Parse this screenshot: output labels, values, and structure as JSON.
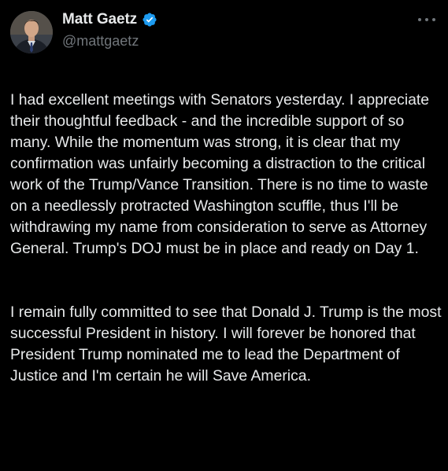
{
  "author": {
    "display_name": "Matt Gaetz",
    "handle": "@mattgaetz",
    "verified": true,
    "avatar_icon": "profile-photo"
  },
  "colors": {
    "background": "#000000",
    "text": "#e7e9ea",
    "secondary": "#71767b",
    "verified": "#1d9bf0"
  },
  "tweet": {
    "paragraph_1": "I had excellent meetings with Senators yesterday.  I appreciate their thoughtful feedback - and the incredible support of so many.  While the momentum was strong, it is clear that my confirmation was unfairly becoming a distraction to the critical work of the Trump/Vance Transition.  There is no time to waste on a needlessly protracted Washington scuffle, thus I'll be withdrawing my name from consideration to serve as Attorney General.  Trump's DOJ must be in place and ready on Day 1.",
    "paragraph_2": "I remain fully committed to see that Donald J. Trump is the most successful President in history.  I will forever be honored that President Trump nominated me to lead the Department of Justice and I'm certain he will Save America."
  },
  "menu": {
    "more_icon": "ellipsis-icon"
  }
}
